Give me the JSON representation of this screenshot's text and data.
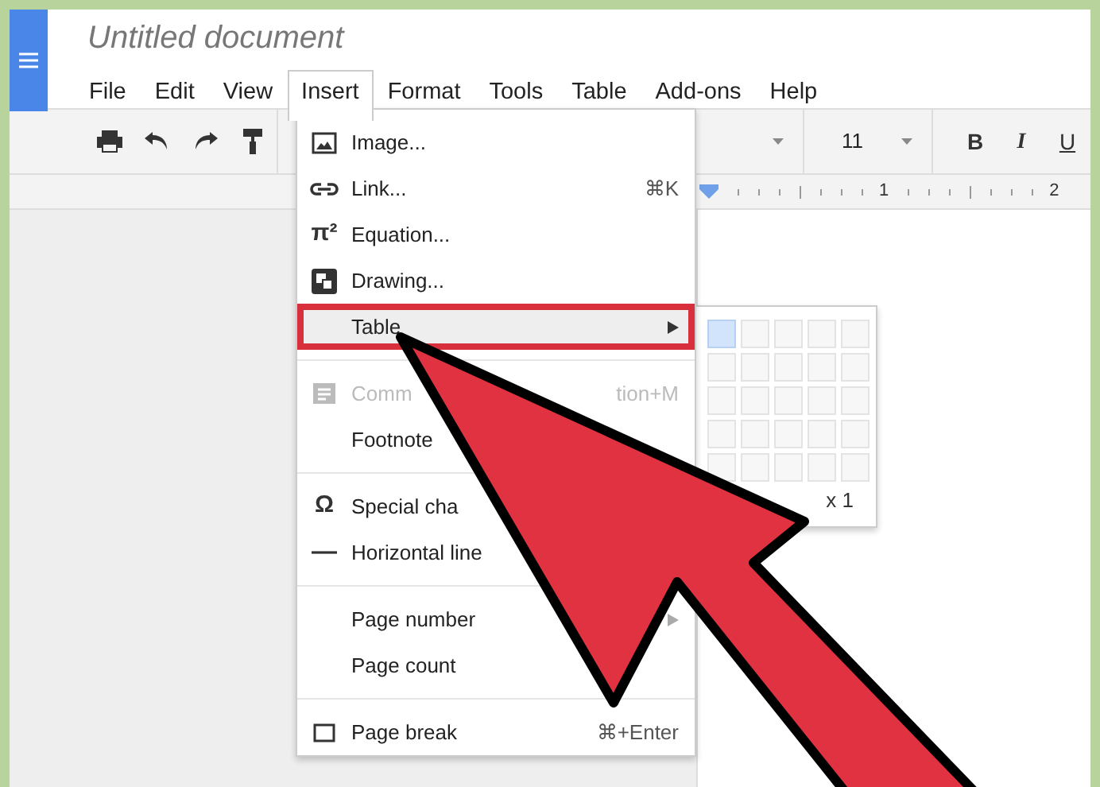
{
  "document": {
    "title": "Untitled document"
  },
  "menu_bar": [
    {
      "label": "File",
      "selected": false
    },
    {
      "label": "Edit",
      "selected": false
    },
    {
      "label": "View",
      "selected": false
    },
    {
      "label": "Insert",
      "selected": true
    },
    {
      "label": "Format",
      "selected": false
    },
    {
      "label": "Tools",
      "selected": false
    },
    {
      "label": "Table",
      "selected": false
    },
    {
      "label": "Add-ons",
      "selected": false
    },
    {
      "label": "Help",
      "selected": false
    }
  ],
  "toolbar": {
    "font_size": "11",
    "format_buttons": [
      "B",
      "I",
      "U"
    ]
  },
  "ruler": {
    "labels": [
      "1",
      "2"
    ]
  },
  "insert_menu": [
    {
      "kind": "item",
      "label": "Image...",
      "selected": false,
      "disabled": false,
      "submenu": false
    },
    {
      "kind": "item",
      "label": "Link...",
      "shortcut": "⌘K",
      "selected": false,
      "disabled": false,
      "submenu": false
    },
    {
      "kind": "item",
      "glyph": "π²",
      "label": "Equation...",
      "selected": false,
      "disabled": false,
      "submenu": false
    },
    {
      "kind": "item",
      "label": "Drawing...",
      "selected": false,
      "disabled": false,
      "submenu": false
    },
    {
      "kind": "item",
      "label": "Table",
      "selected": true,
      "disabled": false,
      "submenu": true
    },
    {
      "kind": "separator"
    },
    {
      "kind": "item",
      "label": "Comm",
      "shortcut": "tion+M",
      "selected": false,
      "disabled": true,
      "submenu": false
    },
    {
      "kind": "item",
      "label": "Footnote",
      "selected": false,
      "disabled": false,
      "submenu": false
    },
    {
      "kind": "separator"
    },
    {
      "kind": "item",
      "glyph": "Ω",
      "label": "Special cha",
      "selected": false,
      "disabled": false,
      "submenu": false
    },
    {
      "kind": "item",
      "label": "Horizontal line",
      "selected": false,
      "disabled": false,
      "submenu": false
    },
    {
      "kind": "separator"
    },
    {
      "kind": "item",
      "label": "Page number",
      "selected": false,
      "disabled": false,
      "submenu": true
    },
    {
      "kind": "item",
      "label": "Page count",
      "selected": false,
      "disabled": false,
      "submenu": false
    },
    {
      "kind": "separator"
    },
    {
      "kind": "item",
      "label": "Page break",
      "shortcut": "⌘+Enter",
      "selected": false,
      "disabled": false,
      "submenu": false
    }
  ],
  "table_grid": {
    "rows": [
      [
        {
          "selected": true
        },
        {
          "selected": false
        },
        {
          "selected": false
        },
        {
          "selected": false
        },
        {
          "selected": false
        }
      ],
      [
        {
          "selected": false
        },
        {
          "selected": false
        },
        {
          "selected": false
        },
        {
          "selected": false
        },
        {
          "selected": false
        }
      ],
      [
        {
          "selected": false
        },
        {
          "selected": false
        },
        {
          "selected": false
        },
        {
          "selected": false
        },
        {
          "selected": false
        }
      ],
      [
        {
          "selected": false
        },
        {
          "selected": false
        },
        {
          "selected": false
        },
        {
          "selected": false
        },
        {
          "selected": false
        }
      ],
      [
        {
          "selected": false
        },
        {
          "selected": false
        },
        {
          "selected": false
        },
        {
          "selected": false
        },
        {
          "selected": false
        }
      ]
    ],
    "size_label": "x 1"
  }
}
